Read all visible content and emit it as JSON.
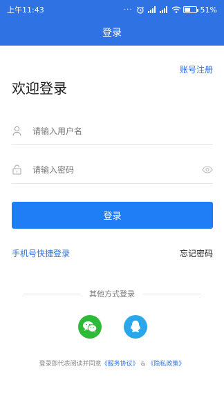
{
  "status_bar": {
    "time": "上午11:43",
    "dots": "···",
    "signal_1": "HD",
    "signal_2": "HD",
    "battery_percent_text": "51%",
    "battery_level": 0.51
  },
  "nav": {
    "title": "登录"
  },
  "register_link": "账号注册",
  "welcome_title": "欢迎登录",
  "form": {
    "username": {
      "value": "",
      "placeholder": "请输入用户名"
    },
    "password": {
      "value": "",
      "placeholder": "请输入密码"
    },
    "login_label": "登录"
  },
  "links": {
    "quick_login": "手机号快捷登录",
    "forgot_password": "忘记密码"
  },
  "other_methods_label": "其他方式登录",
  "social": [
    {
      "name": "wechat-icon",
      "color": "#2dba38"
    },
    {
      "name": "qq-icon",
      "color": "#2aa6ea"
    }
  ],
  "agreement": {
    "prefix": "登录即代表阅读并同意",
    "service": "《服务协议》",
    "amp": " & ",
    "privacy": "《隐私政策》"
  },
  "colors": {
    "primary": "#2f72e4",
    "button": "#1f7ef5"
  }
}
